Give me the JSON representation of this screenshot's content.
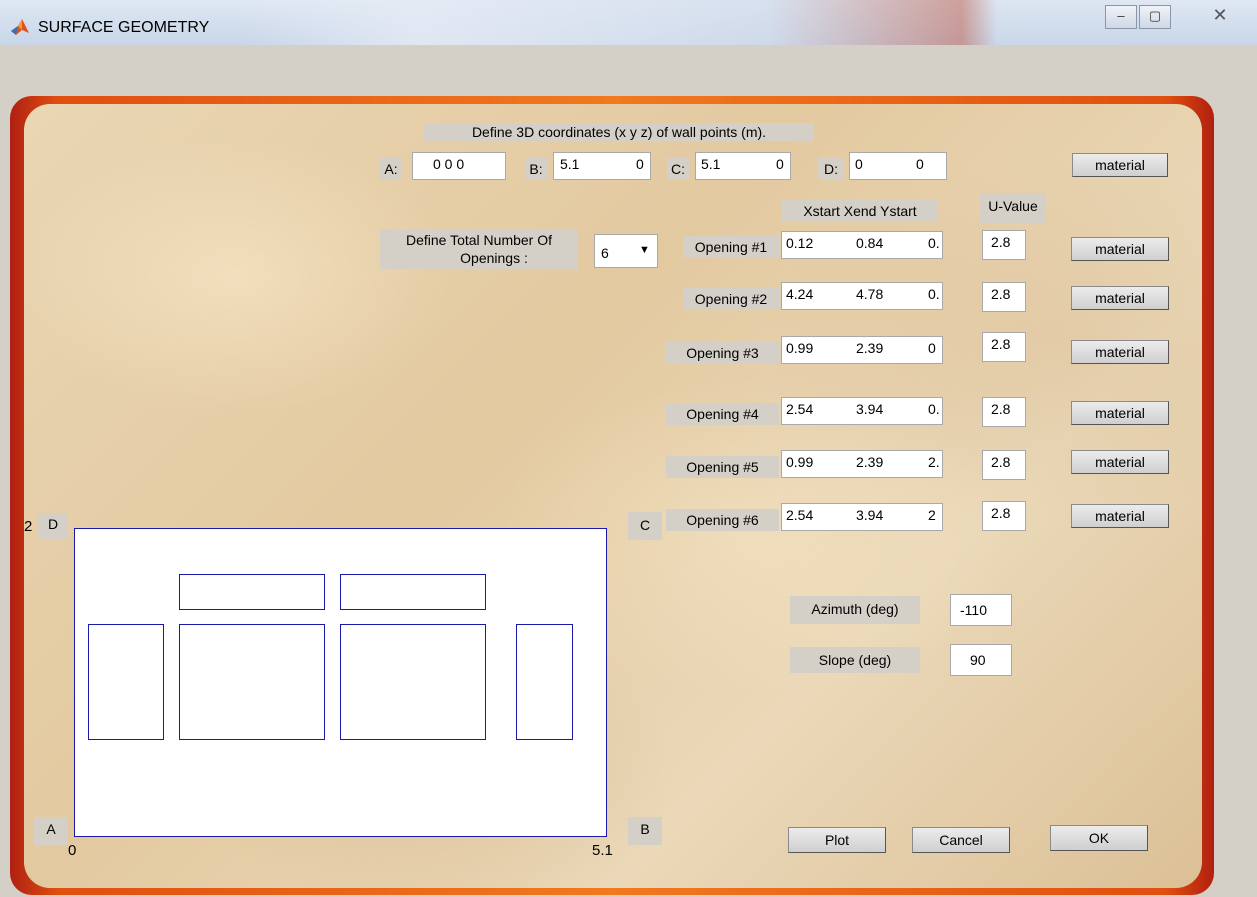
{
  "window": {
    "title": "SURFACE GEOMETRY",
    "minimize": "‒",
    "maximize": "▢",
    "close": "✕"
  },
  "coords": {
    "header": "Define 3D coordinates (x y z) of wall points (m).",
    "a_label": "A:",
    "a_value": "0  0  0",
    "b_label": "B:",
    "b_value_1": "5.1",
    "b_value_2": "0",
    "c_label": "C:",
    "c_value_1": "5.1",
    "c_value_2": "0",
    "d_label": "D:",
    "d_value_1": "0",
    "d_value_2": "0",
    "material": "material"
  },
  "openings_def": {
    "label_line1": "Define Total Number Of",
    "label_line2": "Openings :",
    "selected": "6",
    "arrow": "▼"
  },
  "columns": {
    "coords": "Xstart  Xend Ystart",
    "uvalue": "U-Value"
  },
  "openings": [
    {
      "label": "Opening #1",
      "xstart": "0.12",
      "xend": "0.84",
      "ystart": "0.",
      "uvalue": "2.8",
      "material": "material"
    },
    {
      "label": "Opening #2",
      "xstart": "4.24",
      "xend": "4.78",
      "ystart": "0.",
      "uvalue": "2.8",
      "material": "material"
    },
    {
      "label": "Opening #3",
      "xstart": "0.99",
      "xend": "2.39",
      "ystart": "0",
      "uvalue": "2.8",
      "material": "material"
    },
    {
      "label": "Opening #4",
      "xstart": "2.54",
      "xend": "3.94",
      "ystart": "0.",
      "uvalue": "2.8",
      "material": "material"
    },
    {
      "label": "Opening #5",
      "xstart": "0.99",
      "xend": "2.39",
      "ystart": "2.",
      "uvalue": "2.8",
      "material": "material"
    },
    {
      "label": "Opening #6",
      "xstart": "2.54",
      "xend": "3.94",
      "ystart": "2",
      "uvalue": "2.8",
      "material": "material"
    }
  ],
  "plot": {
    "corner_d": "D",
    "corner_c": "C",
    "corner_a": "A",
    "corner_b": "B",
    "x_min": "0",
    "x_max": "5.1",
    "edge_mark": "2"
  },
  "orientation": {
    "azimuth_label": "Azimuth (deg)",
    "azimuth_value": "-110",
    "slope_label": "Slope (deg)",
    "slope_value": "90"
  },
  "actions": {
    "plot": "Plot",
    "cancel": "Cancel",
    "ok": "OK"
  }
}
